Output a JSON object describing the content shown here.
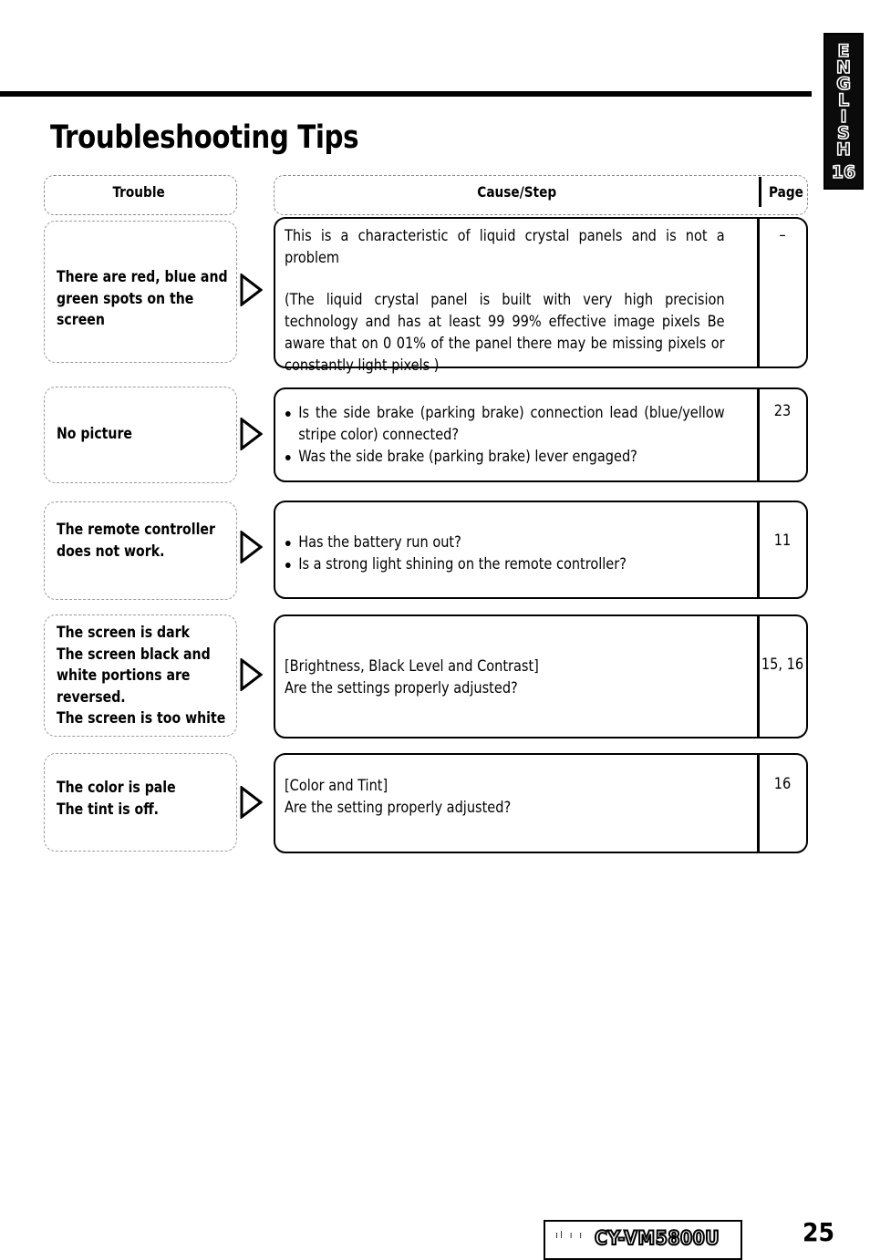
{
  "document": {
    "title": "Troubleshooting Tips",
    "folio": "25",
    "model_number": "CY-VM5800U"
  },
  "side_tab": {
    "language_letters": [
      "E",
      "N",
      "G",
      "L",
      "I",
      "S",
      "H"
    ],
    "number": "16"
  },
  "table": {
    "headers": {
      "trouble": "Trouble",
      "cause": "Cause/Step",
      "page": "Page"
    },
    "rows": [
      {
        "trouble": "There are red, blue and\ngreen spots on the\nscreen",
        "cause_paragraphs": [
          "This is a characteristic of liquid crystal panels and is not a problem",
          "(The liquid crystal panel is built with very high precision technology and has at least 99 99% effective image pixels  Be aware that on 0 01% of the panel there may be missing pixels or constantly light pixels )"
        ],
        "cause_bullets": [],
        "page": "–"
      },
      {
        "trouble": "No picture",
        "cause_paragraphs": [],
        "cause_bullets": [
          "Is the side brake (parking brake) connection lead (blue/yellow stripe color) connected?",
          "Was the side brake (parking brake) lever engaged?"
        ],
        "page": "23"
      },
      {
        "trouble": "The remote controller\ndoes not work.",
        "cause_paragraphs": [],
        "cause_bullets": [
          "Has the battery run out?",
          "Is a strong light shining on the remote controller?"
        ],
        "page": "11"
      },
      {
        "trouble": "The screen is dark\nThe screen black and\nwhite portions are\nreversed.\nThe screen is too white",
        "cause_paragraphs": [
          "[Brightness, Black Level and Contrast]",
          "Are the settings properly adjusted?"
        ],
        "cause_bullets": [],
        "page": "15, 16"
      },
      {
        "trouble": "The color is pale\nThe tint is off.",
        "cause_paragraphs": [
          "[Color and Tint]",
          "Are the setting properly adjusted?"
        ],
        "cause_bullets": [],
        "page": "16"
      }
    ]
  }
}
